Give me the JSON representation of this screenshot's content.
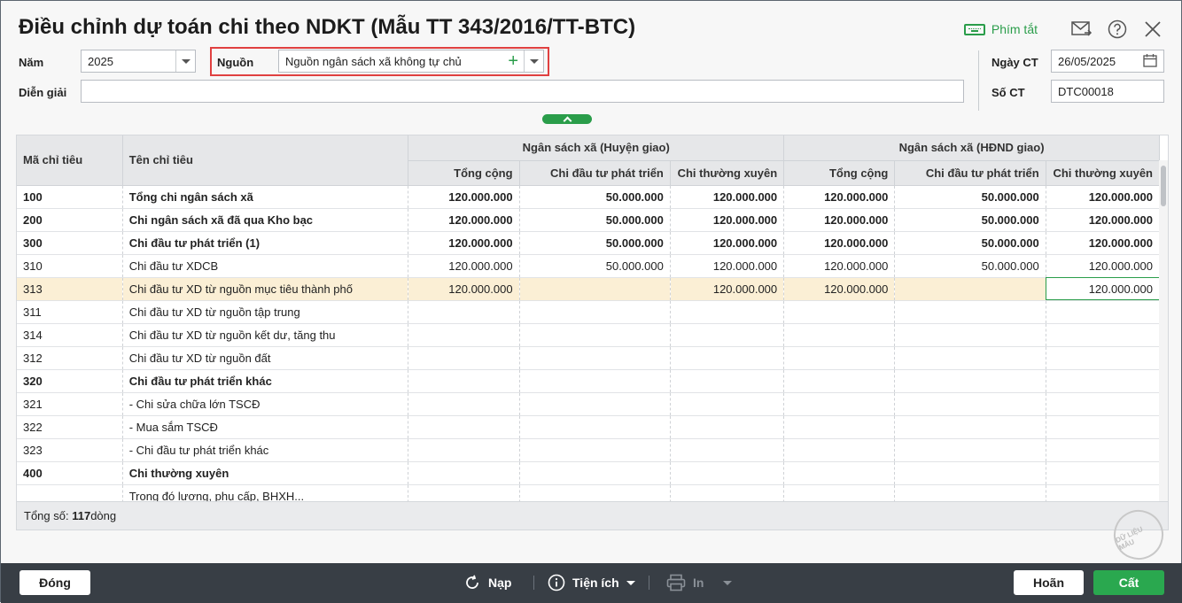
{
  "window": {
    "title": "Điều chỉnh dự toán chi theo NDKT (Mẫu TT 343/2016/TT-BTC)",
    "shortcut_label": "Phím tắt"
  },
  "form": {
    "year_label": "Năm",
    "year_value": "2025",
    "source_label": "Nguồn",
    "source_value": "Nguồn ngân sách  xã không tự chủ",
    "desc_label": "Diễn giải",
    "desc_value": "",
    "date_label": "Ngày CT",
    "date_value": "26/05/2025",
    "doc_label": "Số CT",
    "doc_value": "DTC00018"
  },
  "table": {
    "col_code": "Mã chỉ tiêu",
    "col_name": "Tên chỉ tiêu",
    "group1": "Ngân sách xã (Huyện giao)",
    "group2": "Ngân sách xã (HĐND giao)",
    "sub_total": "Tổng cộng",
    "sub_invest": "Chi đầu tư phát triển",
    "sub_regular": "Chi thường xuyên",
    "rows": [
      {
        "code": "100",
        "name": "Tổng chi ngân sách xã",
        "bold": true,
        "v": [
          "120.000.000",
          "50.000.000",
          "120.000.000",
          "120.000.000",
          "50.000.000",
          "120.000.000"
        ]
      },
      {
        "code": "200",
        "name": "Chi ngân sách xã đã qua Kho bạc",
        "bold": true,
        "v": [
          "120.000.000",
          "50.000.000",
          "120.000.000",
          "120.000.000",
          "50.000.000",
          "120.000.000"
        ]
      },
      {
        "code": "300",
        "name": "Chi đầu tư phát triển (1)",
        "bold": true,
        "v": [
          "120.000.000",
          "50.000.000",
          "120.000.000",
          "120.000.000",
          "50.000.000",
          "120.000.000"
        ]
      },
      {
        "code": "310",
        "name": "Chi đầu tư XDCB",
        "bold": false,
        "v": [
          "120.000.000",
          "50.000.000",
          "120.000.000",
          "120.000.000",
          "50.000.000",
          "120.000.000"
        ]
      },
      {
        "code": "313",
        "name": "Chi đầu tư XD từ nguồn mục tiêu thành phố",
        "bold": false,
        "selected": true,
        "v": [
          "120.000.000",
          "",
          "120.000.000",
          "120.000.000",
          "",
          "120.000.000"
        ]
      },
      {
        "code": "311",
        "name": "Chi đầu tư XD từ nguồn tập trung",
        "bold": false,
        "v": [
          "",
          "",
          "",
          "",
          "",
          ""
        ]
      },
      {
        "code": "314",
        "name": "Chi đầu tư XD từ nguồn kết dư, tăng thu",
        "bold": false,
        "v": [
          "",
          "",
          "",
          "",
          "",
          ""
        ]
      },
      {
        "code": "312",
        "name": "Chi đầu tư XD từ nguồn đất",
        "bold": false,
        "v": [
          "",
          "",
          "",
          "",
          "",
          ""
        ]
      },
      {
        "code": "320",
        "name": "Chi đầu tư phát triển khác",
        "bold": true,
        "v": [
          "",
          "",
          "",
          "",
          "",
          ""
        ]
      },
      {
        "code": "321",
        "name": "- Chi sửa chữa lớn TSCĐ",
        "bold": false,
        "v": [
          "",
          "",
          "",
          "",
          "",
          ""
        ]
      },
      {
        "code": "322",
        "name": "- Mua sắm TSCĐ",
        "bold": false,
        "v": [
          "",
          "",
          "",
          "",
          "",
          ""
        ]
      },
      {
        "code": "323",
        "name": "- Chi đầu tư phát triển khác",
        "bold": false,
        "v": [
          "",
          "",
          "",
          "",
          "",
          ""
        ]
      },
      {
        "code": "400",
        "name": "Chi thường xuyên",
        "bold": true,
        "v": [
          "",
          "",
          "",
          "",
          "",
          ""
        ]
      },
      {
        "code": "",
        "name": "Trong đó lương, phụ cấp, BHXH...",
        "bold": false,
        "v": [
          "",
          "",
          "",
          "",
          "",
          ""
        ]
      }
    ],
    "total_prefix": "Tổng số: ",
    "total_count": "117",
    "total_suffix": " dòng"
  },
  "stamp": {
    "text": "DỮ LIỆU MẪU"
  },
  "footer": {
    "close_label": "Đóng",
    "reload_label": "Nạp",
    "utility_label": "Tiện ích",
    "print_label": "In",
    "cancel_label": "Hoãn",
    "save_label": "Cất"
  },
  "colors": {
    "accent": "#2a9d4a",
    "highlight": "#e04040",
    "selected_row": "#fbefd5",
    "bottom_bar": "#383e45"
  }
}
